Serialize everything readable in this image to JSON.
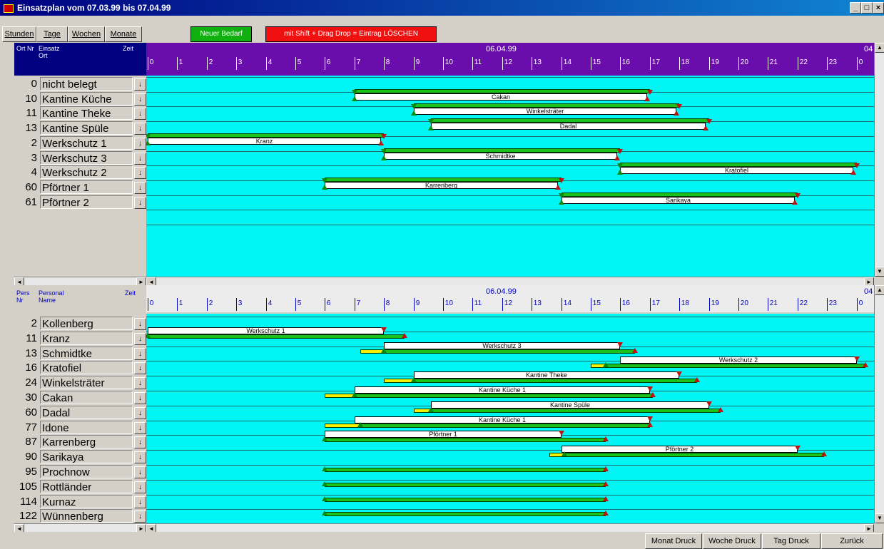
{
  "window": {
    "title": "Einsatzplan vom 07.03.99 bis 07.04.99"
  },
  "toolbar": {
    "stunden": "Stunden",
    "tage": "Tage",
    "wochen": "Wochen",
    "monate": "Monate",
    "neuer_bedarf": "Neuer Bedarf",
    "loeschen_hint": "mit Shift + Drag Drop = Eintrag  LÖSCHEN"
  },
  "top": {
    "col_ort_nr": "Ort Nr",
    "col_einsatz": "Einsatz",
    "col_ort": "Ort",
    "col_zeit": "Zeit",
    "date": "06.04.99",
    "next_date": "04",
    "hours": [
      "0",
      "1",
      "2",
      "3",
      "4",
      "5",
      "6",
      "7",
      "8",
      "9",
      "10",
      "11",
      "12",
      "13",
      "14",
      "15",
      "16",
      "17",
      "18",
      "19",
      "20",
      "21",
      "22",
      "23",
      "0"
    ],
    "rows": [
      {
        "nr": "0",
        "name": "nicht belegt"
      },
      {
        "nr": "10",
        "name": "Kantine Küche"
      },
      {
        "nr": "11",
        "name": "Kantine Theke"
      },
      {
        "nr": "13",
        "name": "Kantine Spüle"
      },
      {
        "nr": "2",
        "name": "Werkschutz 1"
      },
      {
        "nr": "3",
        "name": "Werkschutz 3"
      },
      {
        "nr": "4",
        "name": "Werkschutz 2"
      },
      {
        "nr": "60",
        "name": "Pförtner 1"
      },
      {
        "nr": "61",
        "name": "Pförtner 2"
      }
    ],
    "bars": [
      {
        "row": 1,
        "start": 7,
        "end": 17,
        "label": "Cakan"
      },
      {
        "row": 2,
        "start": 9,
        "end": 18,
        "label": "Winkelsträter"
      },
      {
        "row": 3,
        "start": 9.6,
        "end": 19,
        "label": "Dadal"
      },
      {
        "row": 4,
        "start": 0,
        "end": 8,
        "label": "Kranz"
      },
      {
        "row": 5,
        "start": 8,
        "end": 16,
        "label": "Schmidtke"
      },
      {
        "row": 6,
        "start": 16,
        "end": 24,
        "label": "Kratofiel"
      },
      {
        "row": 7,
        "start": 6,
        "end": 14,
        "label": "Karrenberg"
      },
      {
        "row": 8,
        "start": 14,
        "end": 22,
        "label": "Sarikaya"
      }
    ]
  },
  "bottom": {
    "col_pers_nr": "Pers Nr",
    "col_personal": "Personal",
    "col_name": "Name",
    "col_zeit": "Zeit",
    "date": "06.04.99",
    "next_date": "04",
    "hours": [
      "0",
      "1",
      "2",
      "3",
      "4",
      "5",
      "6",
      "7",
      "8",
      "9",
      "10",
      "11",
      "12",
      "13",
      "14",
      "15",
      "16",
      "17",
      "18",
      "19",
      "20",
      "21",
      "22",
      "23",
      "0"
    ],
    "rows": [
      {
        "nr": "2",
        "name": "Kollenberg"
      },
      {
        "nr": "11",
        "name": "Kranz"
      },
      {
        "nr": "13",
        "name": "Schmidtke"
      },
      {
        "nr": "16",
        "name": "Kratofiel"
      },
      {
        "nr": "24",
        "name": "Winkelsträter"
      },
      {
        "nr": "30",
        "name": "Cakan"
      },
      {
        "nr": "60",
        "name": "Dadal"
      },
      {
        "nr": "77",
        "name": "Idone"
      },
      {
        "nr": "87",
        "name": "Karrenberg"
      },
      {
        "nr": "90",
        "name": "Sarikaya"
      },
      {
        "nr": "95",
        "name": "Prochnow"
      },
      {
        "nr": "105",
        "name": "Rottländer"
      },
      {
        "nr": "114",
        "name": "Kurnaz"
      },
      {
        "nr": "122",
        "name": "Wünnenberg"
      }
    ],
    "bars": [
      {
        "row": 1,
        "wstart": 0,
        "wend": 8,
        "label": "Werkschutz 1",
        "gstart": 0,
        "gend": 8.7,
        "ystart": null,
        "yend": null
      },
      {
        "row": 2,
        "wstart": 8,
        "wend": 16,
        "label": "Werkschutz 3",
        "gstart": 8,
        "gend": 16.5,
        "ystart": 7.2,
        "yend": 8.2
      },
      {
        "row": 3,
        "wstart": 16,
        "wend": 24,
        "label": "Werkschutz 2",
        "gstart": 15.5,
        "gend": 24.3,
        "ystart": 15,
        "yend": 15.5
      },
      {
        "row": 4,
        "wstart": 9,
        "wend": 18,
        "label": "Kantine Theke",
        "gstart": 9,
        "gend": 18.6,
        "ystart": 8,
        "yend": 9
      },
      {
        "row": 5,
        "wstart": 7,
        "wend": 17,
        "label": "Kantine Küche 1",
        "gstart": 7,
        "gend": 17.1,
        "ystart": 6,
        "yend": 7.3
      },
      {
        "row": 6,
        "wstart": 9.6,
        "wend": 19,
        "label": "Kantine Spüle",
        "gstart": 9.6,
        "gend": 19.4,
        "ystart": 9,
        "yend": 9.8
      },
      {
        "row": 7,
        "wstart": 7,
        "wend": 17,
        "label": "Kantine Küche 1",
        "gstart": 7.2,
        "gend": 17,
        "ystart": 6,
        "yend": 7.3
      },
      {
        "row": 8,
        "wstart": 6,
        "wend": 14,
        "label": "Pförtner 1",
        "gstart": 6,
        "gend": 15.5,
        "ystart": null,
        "yend": null
      },
      {
        "row": 9,
        "wstart": 14,
        "wend": 22,
        "label": "Pförtner 2",
        "gstart": 14.1,
        "gend": 22.9,
        "ystart": 13.6,
        "yend": 14.1
      },
      {
        "row": 10,
        "wstart": null,
        "wend": null,
        "label": "",
        "gstart": 6,
        "gend": 15.5,
        "ystart": null,
        "yend": null
      },
      {
        "row": 11,
        "wstart": null,
        "wend": null,
        "label": "",
        "gstart": 6,
        "gend": 15.5,
        "ystart": null,
        "yend": null
      },
      {
        "row": 12,
        "wstart": null,
        "wend": null,
        "label": "",
        "gstart": 6,
        "gend": 15.5,
        "ystart": null,
        "yend": null
      },
      {
        "row": 13,
        "wstart": null,
        "wend": null,
        "label": "",
        "gstart": 6,
        "gend": 15.5,
        "ystart": null,
        "yend": null
      }
    ]
  },
  "footer": {
    "monat": "Monat Druck",
    "woche": "Woche Druck",
    "tag": "Tag Druck",
    "zurueck": "Zurück"
  }
}
